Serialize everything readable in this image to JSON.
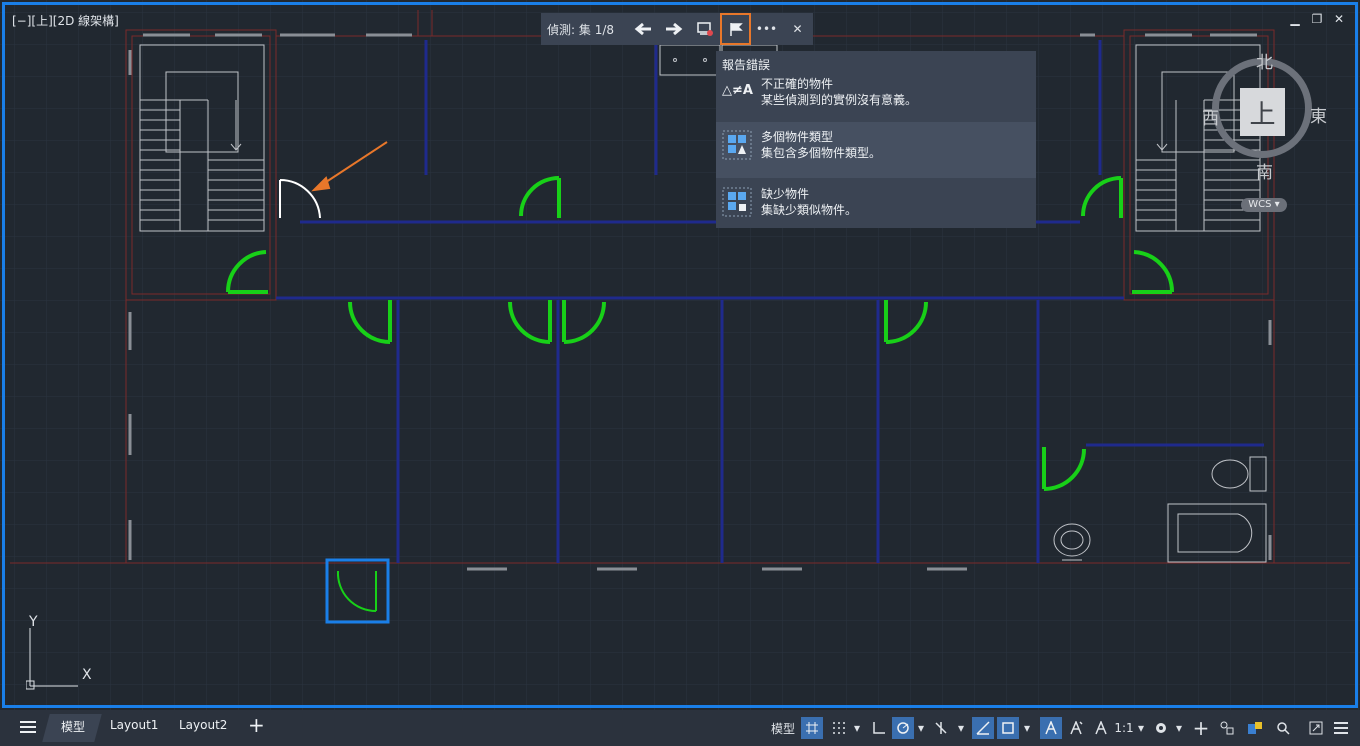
{
  "viewport": {
    "label": "[−][上][2D 線架構]",
    "window_controls": [
      "minimize-icon",
      "restore-icon",
      "close-icon"
    ],
    "minimize": "▁",
    "restore": "❐",
    "close": "✕"
  },
  "detection_bar": {
    "label": "偵測: 集",
    "counter": "1/8",
    "buttons": [
      "arrow-left-icon",
      "arrow-right-icon",
      "select-set-icon",
      "report-flag-icon",
      "more-icon",
      "close-icon"
    ],
    "more": "•••",
    "close": "✕"
  },
  "report_flyout": {
    "title": "報告錯誤",
    "items": [
      {
        "icon": "not-equal-icon",
        "glyph": "△≠A",
        "title": "不正確的物件",
        "desc": "某些偵測到的實例沒有意義。"
      },
      {
        "icon": "multiple-types-icon",
        "title": "多個物件類型",
        "desc": "集包含多個物件類型。"
      },
      {
        "icon": "missing-object-icon",
        "title": "缺少物件",
        "desc": "集缺少類似物件。"
      }
    ]
  },
  "viewcube": {
    "face": "上",
    "north": "北",
    "south": "南",
    "east": "東",
    "west": "西",
    "wcs": "WCS ▾"
  },
  "ucs": {
    "y_label": "Y",
    "x_label": "X"
  },
  "statusbar": {
    "menu_icon": "hamburger-icon",
    "tabs": [
      "模型",
      "Layout1",
      "Layout2"
    ],
    "add_tab": "+",
    "model_label": "模型",
    "scale_label": "1:1",
    "colors": {
      "accent": "#1a7fe8",
      "highlight": "#e8772a",
      "door": "#18d018",
      "wall": "#202a8a"
    }
  }
}
